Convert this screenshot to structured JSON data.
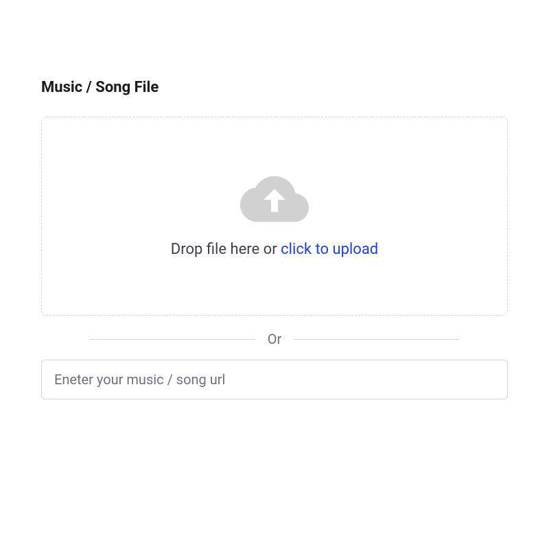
{
  "section": {
    "title": "Music / Song File"
  },
  "dropzone": {
    "prompt_prefix": "Drop file here or ",
    "prompt_link": "click to upload"
  },
  "divider": {
    "label": "Or"
  },
  "url_input": {
    "placeholder": "Eneter your music / song url",
    "value": ""
  },
  "icons": {
    "cloud_upload": "cloud-upload-icon"
  },
  "colors": {
    "link": "#1a3ee8",
    "border": "#d1d5db",
    "icon": "#d1d1d1"
  }
}
